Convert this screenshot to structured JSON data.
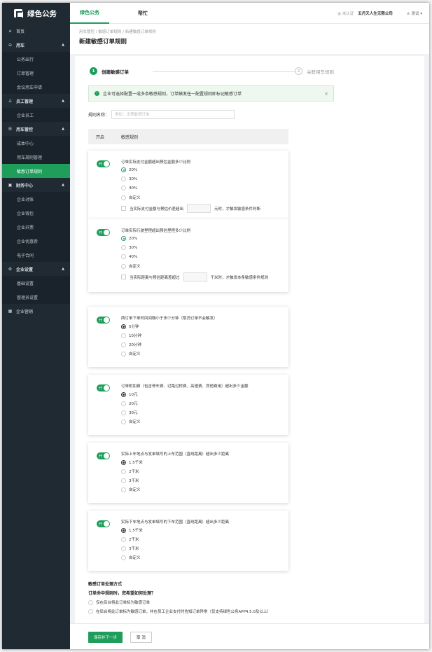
{
  "app": {
    "logo_text": "绿色公务"
  },
  "sidebar": {
    "home": "首页",
    "car": {
      "label": "用车",
      "items": [
        "公务出行",
        "订单管理",
        "会议用车申请"
      ]
    },
    "staff": {
      "label": "员工管理",
      "items": [
        "企业员工"
      ]
    },
    "control": {
      "label": "用车管控",
      "items": [
        "成本中心",
        "用车规则管理",
        "敏感订单规则"
      ]
    },
    "finance": {
      "label": "财务中心",
      "items": [
        "企业对账",
        "企业钱包",
        "企业开票",
        "企业优惠券",
        "电子合同"
      ]
    },
    "settings": {
      "label": "企业设置",
      "items": [
        "基础设置",
        "管理员设置"
      ]
    },
    "marketing": "企业营销"
  },
  "header": {
    "tab_active": "绿色公务",
    "tab_help": "帮忙",
    "certified": "未认证",
    "company": "五丹天人生无限公司",
    "user": "测试"
  },
  "breadcrumb": "用车管控 / 敏感订单规则 / 新建敏感订单规则",
  "page_title": "新建敏感订单规则",
  "steps": [
    {
      "num": "1",
      "label": "创建敏感订单"
    },
    {
      "num": "2",
      "label": "关联用车规则"
    }
  ],
  "alert": {
    "text": "企业可选择配置一或多条敏感规则，订单触发任一配置规则即标记敏感订单",
    "close": "×"
  },
  "rule_name": {
    "label": "规则名称：",
    "placeholder": "例如：出差敏感订单"
  },
  "table_head": {
    "col1": "开启",
    "col2": "敏感规则"
  },
  "toggle_text": "开",
  "rules": [
    {
      "question": "订单实际支付金额超出预估金额多少比例",
      "options": [
        "20%",
        "30%",
        "40%",
        "自定义"
      ],
      "selected": 0,
      "check": {
        "pre": "当实际支付金额与预估价差超出",
        "post": "元时，才触发敏感条件判断"
      }
    },
    {
      "question": "订单实际行驶里程超出预估里程多少比例",
      "options": [
        "20%",
        "30%",
        "40%",
        "自定义"
      ],
      "selected": 0,
      "check": {
        "pre": "当实际距离与预估距离差超过",
        "post": "千米时，才触发本条敏感条件规则"
      }
    },
    {
      "question": "两订单下单时间间隔小于多少分钟（取消订单不会触发）",
      "options": [
        "5分钟",
        "10分钟",
        "20分钟",
        "自定义"
      ],
      "selected": 0
    },
    {
      "question": "订单附加费（包含停车费、过路过桥费、高速费、其他费用）超出多少金额",
      "options": [
        "10元",
        "20元",
        "30元",
        "自定义"
      ],
      "selected": 0
    },
    {
      "question": "实际上车地点与发单填写的上车范围（直线距离）超出多少距离",
      "options": [
        "1.5千米",
        "2千米",
        "3千米",
        "自定义"
      ],
      "selected": 0
    },
    {
      "question": "实际下车地点与发单填写的下车范围（直线距离）超出多少距离",
      "options": [
        "1.5千米",
        "2千米",
        "3千米",
        "自定义"
      ],
      "selected": 0
    }
  ],
  "handling": {
    "title": "敏感订单处理方式",
    "question": "订单命中规则时，您希望如何处理？",
    "options": [
      "仅在后台将此订单标为敏感订单",
      "在后台将此订单标为敏感订单，并在员工企业支付时告知订单异常（仅支持绿色公务APP4.5.0及以上）"
    ]
  },
  "footer": {
    "save": "保存并下一步",
    "cancel": "取 消"
  },
  "colors": {
    "brand": "#1e9e5a",
    "sidebar": "#1f2a33"
  }
}
